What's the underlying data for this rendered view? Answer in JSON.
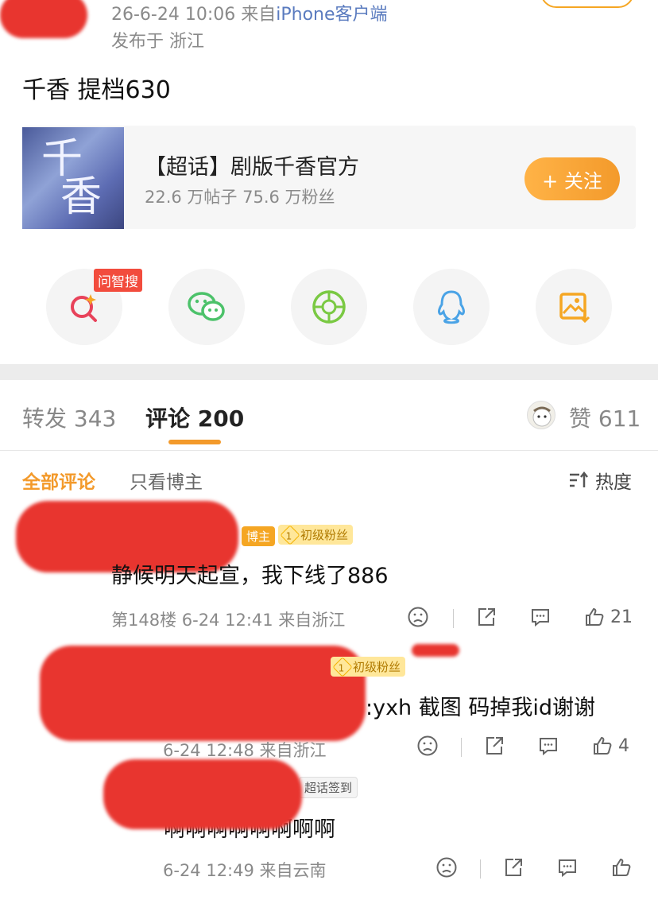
{
  "post": {
    "time_source_prefix": "26-6-24 10:06  来自",
    "time_source_link": "iPhone客户端",
    "location": "发布于 浙江",
    "text": "千香 提档630"
  },
  "topic": {
    "cover_chars": [
      "千",
      "香"
    ],
    "title": "【超话】剧版千香官方",
    "stats": "22.6 万帖子 75.6 万粉丝",
    "follow_label": "+ 关注"
  },
  "share": {
    "badge": "问智搜",
    "items": [
      "search-ai-icon",
      "wechat-icon",
      "moments-icon",
      "qq-icon",
      "save-image-icon"
    ],
    "colors": {
      "search": "#e8425a",
      "wechat": "#4cc26a",
      "moments": "#7ac943",
      "qq": "#4aa3e6",
      "save": "#f5a623"
    }
  },
  "tabs": {
    "repost_label": "转发",
    "repost_count": "343",
    "comment_label": "评论",
    "comment_count": "200",
    "like_label": "赞",
    "like_count": "611"
  },
  "filters": {
    "all": "全部评论",
    "blogger_only": "只看博主",
    "sort": "热度"
  },
  "comments": [
    {
      "tags": {
        "blogger": "博主",
        "fan_level": "1",
        "fan": "初级粉丝"
      },
      "text": "静候明天起宣，我下线了886",
      "meta": "第148楼  6-24 12:41  来自浙江",
      "likes": "21"
    },
    {
      "tags": {
        "fan_level": "1",
        "fan": "初级粉丝"
      },
      "text": ":yxh 截图 码掉我id谢谢",
      "meta": "6-24 12:48  来自浙江",
      "likes": "4"
    },
    {
      "tags": {
        "topic": "超话签到"
      },
      "text": "啊啊啊啊啊啊啊啊",
      "meta": "6-24 12:49  来自云南",
      "likes": ""
    }
  ],
  "accent": "#f39a2b",
  "redaction_color": "#e8352f"
}
